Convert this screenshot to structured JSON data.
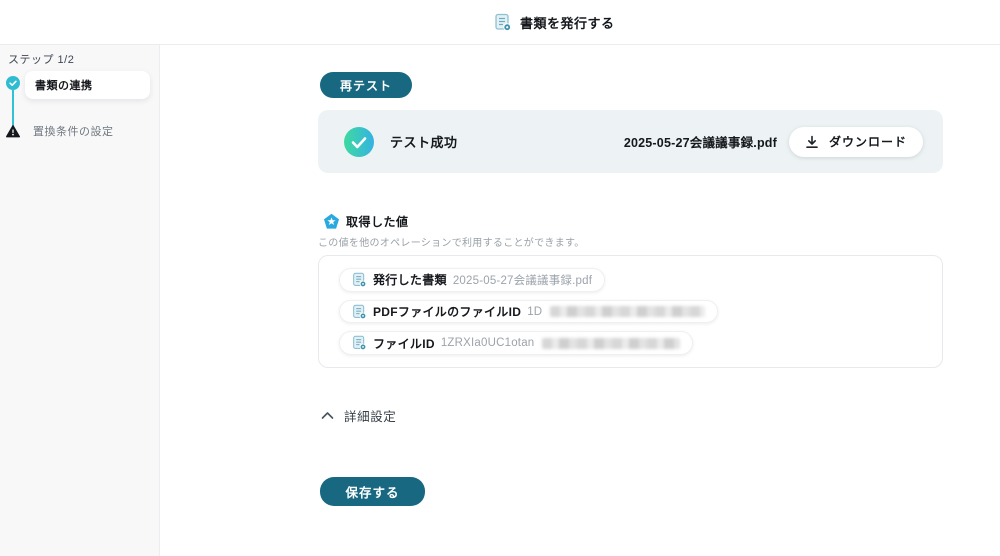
{
  "header": {
    "title": "書類を発行する"
  },
  "sidebar": {
    "step_label": "ステップ 1/2",
    "steps": [
      {
        "label": "書類の連携",
        "status": "complete",
        "active": true
      },
      {
        "label": "置換条件の設定",
        "status": "warning",
        "active": false
      }
    ]
  },
  "main": {
    "retest_button": "再テスト",
    "test_result": {
      "status_text": "テスト成功",
      "file_name": "2025-05-27会議議事録.pdf",
      "download_label": "ダウンロード"
    },
    "obtained_values": {
      "title": "取得した値",
      "description": "この値を他のオペレーションで利用することができます。",
      "items": [
        {
          "label": "発行した書類",
          "value": "2025-05-27会議議事録.pdf",
          "redacted": false
        },
        {
          "label": "PDFファイルのファイルID",
          "value": "1D",
          "redacted": true
        },
        {
          "label": "ファイルID",
          "value": "1ZRXIa0UC1otan",
          "redacted": true
        }
      ]
    },
    "advanced_settings_label": "詳細設定",
    "save_button": "保存する"
  },
  "colors": {
    "accent_teal": "#176880",
    "step_check_teal": "#2fc3d5",
    "success_gradient_start": "#3edaa0",
    "success_gradient_end": "#34b2e2",
    "result_card_bg": "#edf3f4",
    "values_icon_blue": "#2aa9e0",
    "sidebar_bg": "#f8f8f9"
  }
}
